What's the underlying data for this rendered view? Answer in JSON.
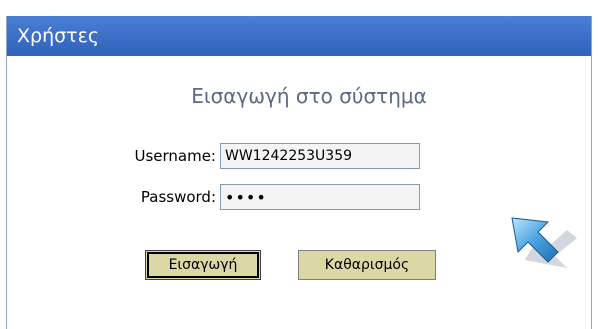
{
  "panel": {
    "header_title": "Χρήστες"
  },
  "login": {
    "title": "Εισαγωγή στο σύστημα",
    "username_label": "Username:",
    "username_value": "WW1242253U359",
    "password_label": "Password:",
    "password_value": "••••",
    "submit_label": "Εισαγωγή",
    "clear_label": "Καθαρισμός"
  },
  "colors": {
    "header_bg": "#3a6fc8",
    "button_bg": "#dcd8a6",
    "title_text": "#5a6a80"
  },
  "icons": {
    "pointer": "arrow-pointer-icon"
  }
}
